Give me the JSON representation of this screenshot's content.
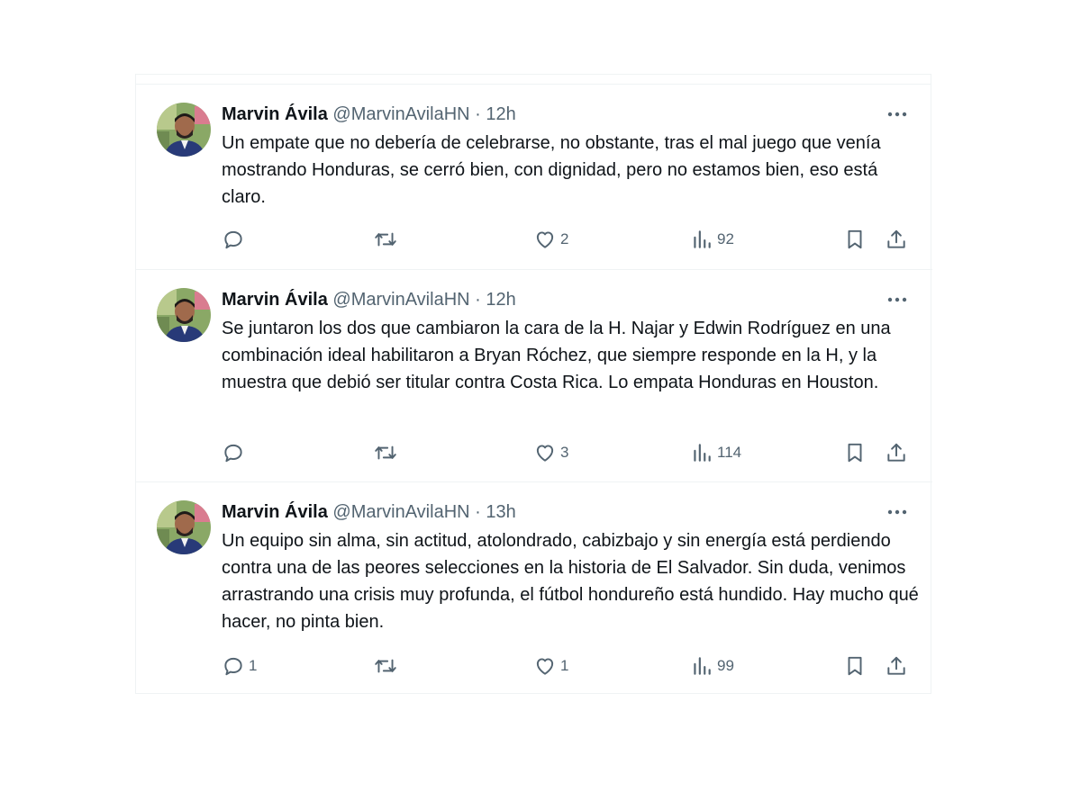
{
  "tweets": [
    {
      "name": "Marvin Ávila",
      "handle": "@MarvinAvilaHN",
      "separator": "·",
      "time": "12h",
      "text": "Un empate que no debería de celebrarse, no obstante, tras el mal juego que venía mostrando Honduras, se cerró bien, con dignidad, pero no estamos bien, eso está claro.",
      "replies": "",
      "retweets": "",
      "likes": "2",
      "views": "92"
    },
    {
      "name": "Marvin Ávila",
      "handle": "@MarvinAvilaHN",
      "separator": "·",
      "time": "12h",
      "text": "Se juntaron los dos que cambiaron la cara de la H. Najar y Edwin Rodríguez en una combinación ideal habilitaron a Bryan Róchez, que siempre responde en la H, y la muestra que debió ser titular contra Costa Rica. Lo empata Honduras en Houston.",
      "replies": "",
      "retweets": "",
      "likes": "3",
      "views": "114"
    },
    {
      "name": "Marvin Ávila",
      "handle": "@MarvinAvilaHN",
      "separator": "·",
      "time": "13h",
      "text": "Un equipo sin alma, sin actitud, atolondrado, cabizbajo y sin energía está perdiendo contra una de las peores selecciones en la historia de El Salvador. Sin duda, venimos arrastrando una crisis muy profunda, el fútbol hondureño está hundido. Hay mucho qué hacer, no pinta bien.",
      "replies": "1",
      "retweets": "",
      "likes": "1",
      "views": "99"
    }
  ],
  "icons": {
    "more": "more-horizontal-icon",
    "reply": "reply-icon",
    "retweet": "retweet-icon",
    "like": "heart-icon",
    "views": "views-icon",
    "bookmark": "bookmark-icon",
    "share": "share-icon"
  },
  "colors": {
    "text": "#0f1419",
    "secondary": "#536471",
    "border": "#eff3f4"
  }
}
